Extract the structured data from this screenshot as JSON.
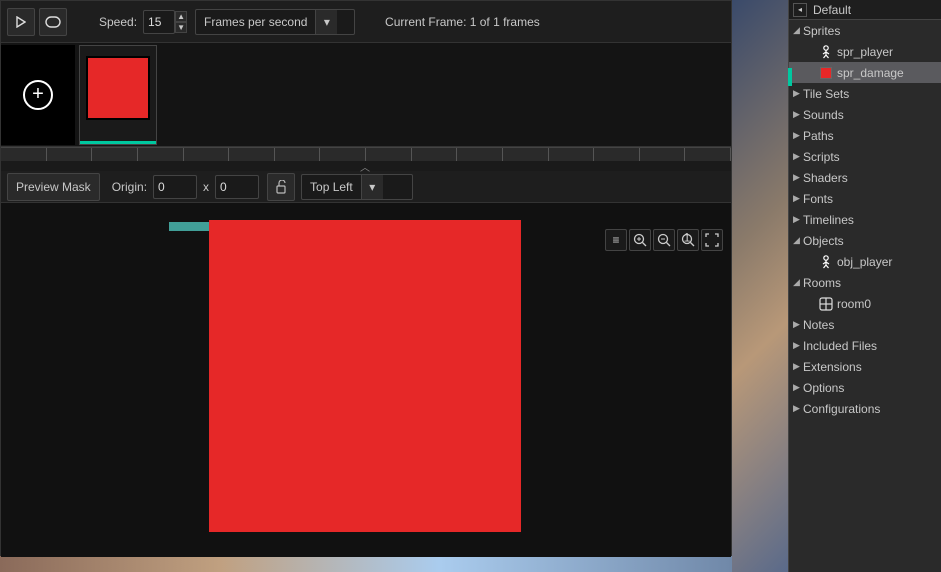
{
  "toolbar": {
    "speed_label": "Speed:",
    "speed_value": "15",
    "speed_unit": "Frames per second",
    "current_frame_text": "Current Frame: 1 of 1 frames"
  },
  "subtoolbar": {
    "preview_mask": "Preview Mask",
    "origin_label": "Origin:",
    "origin_x": "0",
    "origin_xy_sep": "x",
    "origin_y": "0",
    "origin_preset": "Top Left"
  },
  "resources": {
    "header": "Default",
    "items": [
      {
        "label": "Sprites",
        "expanded": true,
        "children": [
          {
            "label": "spr_player",
            "icon": "person"
          },
          {
            "label": "spr_damage",
            "icon": "red",
            "selected": true
          }
        ]
      },
      {
        "label": "Tile Sets",
        "expanded": false
      },
      {
        "label": "Sounds",
        "expanded": false
      },
      {
        "label": "Paths",
        "expanded": false
      },
      {
        "label": "Scripts",
        "expanded": false
      },
      {
        "label": "Shaders",
        "expanded": false
      },
      {
        "label": "Fonts",
        "expanded": false
      },
      {
        "label": "Timelines",
        "expanded": false
      },
      {
        "label": "Objects",
        "expanded": true,
        "children": [
          {
            "label": "obj_player",
            "icon": "person"
          }
        ]
      },
      {
        "label": "Rooms",
        "expanded": true,
        "children": [
          {
            "label": "room0",
            "icon": "room"
          }
        ]
      },
      {
        "label": "Notes",
        "expanded": false
      },
      {
        "label": "Included Files",
        "expanded": false
      },
      {
        "label": "Extensions",
        "expanded": false
      },
      {
        "label": "Options",
        "expanded": false
      },
      {
        "label": "Configurations",
        "expanded": false
      }
    ]
  }
}
